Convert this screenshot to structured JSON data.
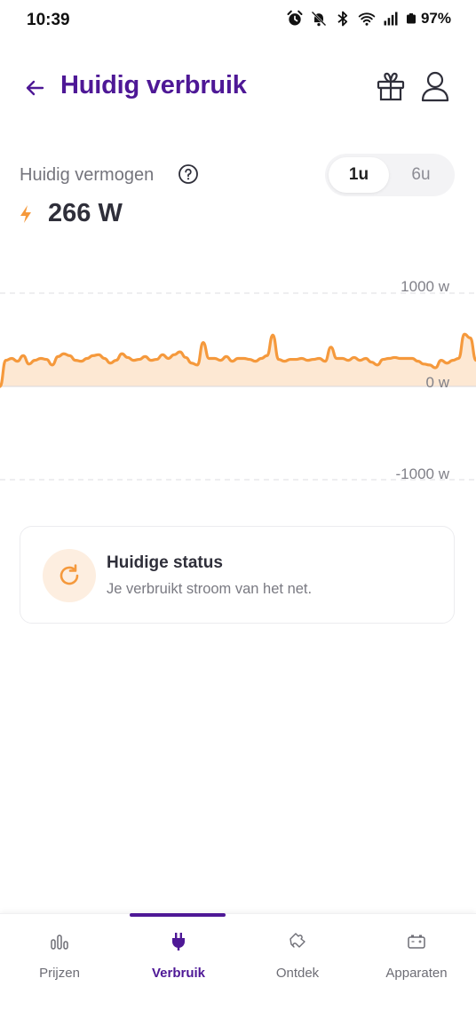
{
  "status_bar": {
    "time": "10:39",
    "battery": "97%",
    "icons": [
      "alarm-icon",
      "bell-off-icon",
      "bluetooth-icon",
      "wifi-icon",
      "signal-icon",
      "battery-icon"
    ]
  },
  "header": {
    "title": "Huidig verbruik",
    "back_icon": "arrow-left-icon",
    "actions": [
      "gift-icon",
      "user-icon"
    ]
  },
  "power": {
    "label": "Huidig vermogen",
    "value": "266 W",
    "range_options": [
      "1u",
      "6u"
    ],
    "selected_range": "1u"
  },
  "chart_data": {
    "type": "area",
    "title": "",
    "xlabel": "",
    "ylabel": "",
    "tick_labels": [
      "1000 w",
      "0 w",
      "-1000 w"
    ],
    "ylim": [
      -1000,
      1000
    ],
    "grid": true,
    "series": [
      {
        "values": [
          0,
          280,
          300,
          270,
          330,
          240,
          280,
          300,
          290,
          230,
          320,
          350,
          330,
          280,
          270,
          300,
          330,
          340,
          300,
          250,
          280,
          350,
          310,
          280,
          290,
          320,
          280,
          290,
          340,
          300,
          340,
          370,
          310,
          250,
          230,
          470,
          300,
          300,
          280,
          320,
          270,
          300,
          300,
          290,
          270,
          300,
          330,
          550,
          290,
          270,
          290,
          290,
          300,
          280,
          290,
          300,
          270,
          420,
          300,
          300,
          280,
          310,
          280,
          300,
          260,
          230,
          290,
          300,
          310,
          300,
          300,
          300,
          270,
          240,
          230,
          200,
          280,
          250,
          280,
          300,
          560,
          520,
          280
        ]
      }
    ],
    "colors": {
      "line": "#f5993c",
      "fill": "#fde8d3"
    }
  },
  "status_card": {
    "title": "Huidige status",
    "description": "Je verbruikt stroom van het net.",
    "icon": "refresh-icon"
  },
  "bottom_nav": {
    "items": [
      {
        "label": "Prijzen",
        "icon": "bar-chart-icon"
      },
      {
        "label": "Verbruik",
        "icon": "plug-icon"
      },
      {
        "label": "Ontdek",
        "icon": "puzzle-icon"
      },
      {
        "label": "Apparaten",
        "icon": "battery-device-icon"
      }
    ],
    "active": "Verbruik"
  },
  "colors": {
    "brand_purple": "#4e1896",
    "accent_orange": "#f5993c"
  }
}
